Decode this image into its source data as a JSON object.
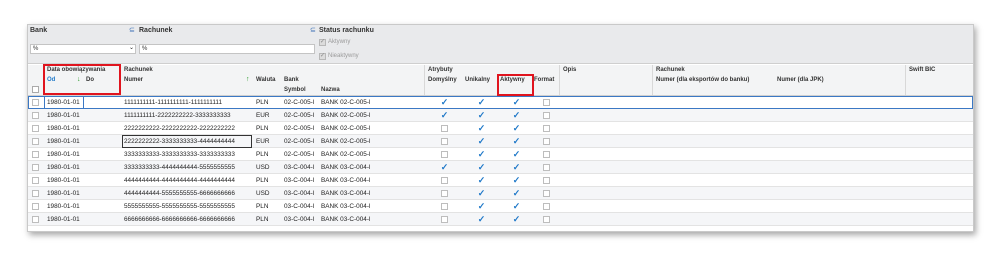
{
  "filters": {
    "bank_label": "Bank",
    "bank_value": "%",
    "rachunek_label": "Rachunek",
    "rachunek_value": "%",
    "status_label": "Status rachunku",
    "aktywny_label": "Aktywny",
    "nieaktywny_label": "Nieaktywny",
    "sort_icon": "sort-icon"
  },
  "headers": {
    "data_obowiazywania": "Data obowiązywania",
    "od": "Od",
    "do": "Do",
    "rachunek": "Rachunek",
    "numer": "Numer",
    "waluta": "Waluta",
    "bank": "Bank",
    "symbol": "Symbol",
    "nazwa": "Nazwa",
    "atrybuty": "Atrybuty",
    "domyslny": "Domyślny",
    "unikalny": "Unikalny",
    "aktywny": "Aktywny",
    "format": "Format",
    "opis": "Opis",
    "rachunek2": "Rachunek",
    "numer_eksport": "Numer (dla eksportów do banku)",
    "numer_jpk": "Numer (dla JPK)",
    "swift": "Swift BIC"
  },
  "rows": [
    {
      "od": "1980-01-01",
      "numer": "1111111111-1111111111-1111111111",
      "waluta": "PLN",
      "symbol": "02-C-005-l",
      "nazwa": "BANK 02-C-005-l",
      "domyslny": true,
      "unikalny": true,
      "aktywny": true
    },
    {
      "od": "1980-01-01",
      "numer": "1111111111-2222222222-3333333333",
      "waluta": "EUR",
      "symbol": "02-C-005-l",
      "nazwa": "BANK 02-C-005-l",
      "domyslny": true,
      "unikalny": true,
      "aktywny": true
    },
    {
      "od": "1980-01-01",
      "numer": "2222222222-2222222222-2222222222",
      "waluta": "PLN",
      "symbol": "02-C-005-l",
      "nazwa": "BANK 02-C-005-l",
      "domyslny": false,
      "unikalny": true,
      "aktywny": true
    },
    {
      "od": "1980-01-01",
      "numer": "2222222222-3333333333-4444444444",
      "waluta": "EUR",
      "symbol": "02-C-005-l",
      "nazwa": "BANK 02-C-005-l",
      "domyslny": false,
      "unikalny": true,
      "aktywny": true
    },
    {
      "od": "1980-01-01",
      "numer": "3333333333-3333333333-3333333333",
      "waluta": "PLN",
      "symbol": "02-C-005-l",
      "nazwa": "BANK 02-C-005-l",
      "domyslny": false,
      "unikalny": true,
      "aktywny": true
    },
    {
      "od": "1980-01-01",
      "numer": "3333333333-4444444444-5555555555",
      "waluta": "USD",
      "symbol": "03-C-004-l",
      "nazwa": "BANK 03-C-004-l",
      "domyslny": true,
      "unikalny": true,
      "aktywny": true
    },
    {
      "od": "1980-01-01",
      "numer": "4444444444-4444444444-4444444444",
      "waluta": "PLN",
      "symbol": "03-C-004-l",
      "nazwa": "BANK 03-C-004-l",
      "domyslny": false,
      "unikalny": true,
      "aktywny": true
    },
    {
      "od": "1980-01-01",
      "numer": "4444444444-5555555555-6666666666",
      "waluta": "USD",
      "symbol": "03-C-004-l",
      "nazwa": "BANK 03-C-004-l",
      "domyslny": false,
      "unikalny": true,
      "aktywny": true
    },
    {
      "od": "1980-01-01",
      "numer": "5555555555-5555555555-5555555555",
      "waluta": "PLN",
      "symbol": "03-C-004-l",
      "nazwa": "BANK 03-C-004-l",
      "domyslny": false,
      "unikalny": true,
      "aktywny": true
    },
    {
      "od": "1980-01-01",
      "numer": "6666666666-6666666666-6666666666",
      "waluta": "PLN",
      "symbol": "03-C-004-l",
      "nazwa": "BANK 03-C-004-l",
      "domyslny": false,
      "unikalny": true,
      "aktywny": true
    }
  ],
  "colors": {
    "accent": "#1e78c8",
    "highlight": "#e0141e"
  }
}
